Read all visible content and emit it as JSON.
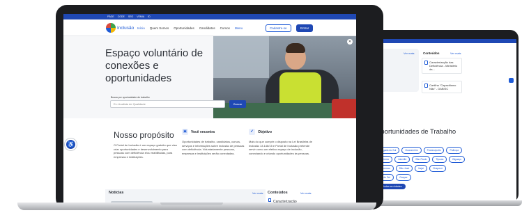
{
  "govbar": {
    "items": [
      "PÁGE",
      "CODE",
      "SEO",
      "VEMIA",
      "ID"
    ]
  },
  "nav": {
    "logo_text": "Inclusão",
    "items": [
      "Início",
      "Quem Somos",
      "Oportunidades",
      "Candidatos",
      "Cursos",
      "Menu"
    ],
    "register_label": "Cadastre-se",
    "login_label": "Entrar"
  },
  "hero": {
    "title": "Espaço voluntário de conexões e oportunidades",
    "search_label": "Busca por oportunidade de trabalho",
    "search_placeholder": "Ex: Analista de Qualidade",
    "search_button": "Buscar"
  },
  "purpose": {
    "title": "Nosso propósito",
    "text": "O Portal de Inclusão é um espaço gratuito que visa criar oportunidades e desenvolvimento para pessoas com deficiência e/ou reabilitadas, para empresas e instituições.",
    "features": [
      {
        "icon": "briefcase-icon",
        "glyph": "▣",
        "title": "Você encontra",
        "text": "Oportunidades de trabalho, candidatos, cursos, serviços e informações sobre inclusão de pessoas com deficiência. Voluntariamente pessoas, empresas e instituições serão conectadas."
      },
      {
        "icon": "target-icon",
        "glyph": "✔",
        "title": "Objetivo",
        "text": "Mais do que cumprir o disposto na Lei Brasileira de Inclusão 13.146/15 e Portal de Inclusão pretende servir como um efetivo espaço de inclusão, conectando e criando oportunidades às pessoas."
      }
    ]
  },
  "news": {
    "title": "Notícias",
    "see_more": "Ver mais"
  },
  "contents": {
    "title": "Conteúdos",
    "see_more": "Ver mais",
    "first_item": "Caracterização"
  },
  "accessibility": {
    "icon": "accessibility-icon",
    "glyph": "♿"
  },
  "second_screen": {
    "left_see_more": "Ver mais",
    "contents_title": "Conteúdos",
    "contents_see_more": "Ver mais",
    "items": [
      "Caracterização das Deficiência - Ministério da...",
      "Cartilha \"Capacitismo Não\" - DABISC"
    ],
    "opportunities_title": "Oportunidades de Trabalho",
    "chips": [
      "Jangada do Sul",
      "Guaramirim",
      "Florianópolis",
      "Palhoça",
      "Criciúma",
      "Joinville",
      "São Paulo",
      "Tijucas",
      "Biguaçu",
      "Blumenau",
      "São José",
      "Itajaí",
      "Chapecó",
      "Rio do Sul",
      "Gaspar"
    ],
    "all_cities_button": "Ver todas as cidades"
  }
}
